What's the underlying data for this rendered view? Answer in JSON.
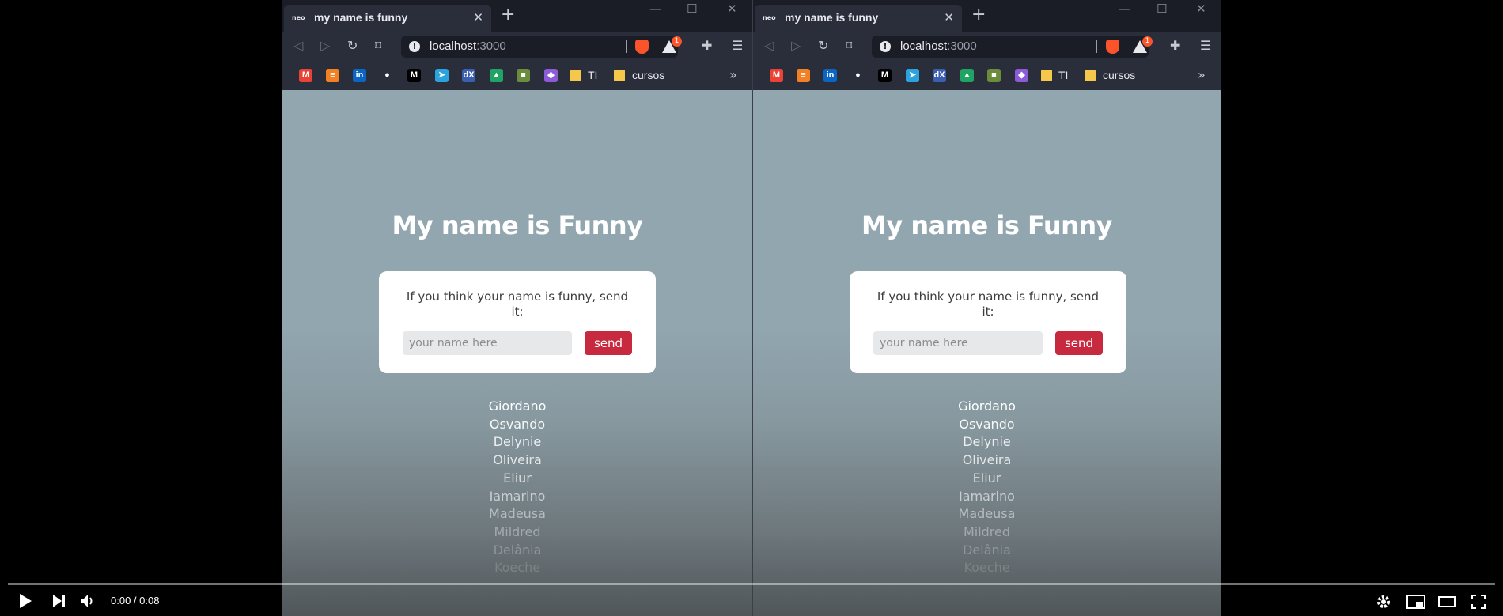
{
  "browser": {
    "tab_title": "my name is funny",
    "url_host": "localhost",
    "url_port": ":3000",
    "rewards_count": "1",
    "bookmarks": [
      {
        "icon": "gmail-icon",
        "color": "#ea4335",
        "glyph": "M"
      },
      {
        "icon": "stack-overflow-icon",
        "color": "#f48024",
        "glyph": "≡"
      },
      {
        "icon": "linkedin-icon",
        "color": "#0a66c2",
        "glyph": "in"
      },
      {
        "icon": "github-icon",
        "color": "#2a2e3b",
        "glyph": "●"
      },
      {
        "icon": "medium-icon",
        "color": "#000000",
        "glyph": "M"
      },
      {
        "icon": "telegram-icon",
        "color": "#2aa3df",
        "glyph": "➤"
      },
      {
        "icon": "edx-icon",
        "color": "#3a5fb0",
        "glyph": "dX"
      },
      {
        "icon": "google-drive-icon",
        "color": "#1fa463",
        "glyph": "▲"
      },
      {
        "icon": "minecraft-icon",
        "color": "#6b8c3a",
        "glyph": "■"
      },
      {
        "icon": "twitch-icon",
        "color": "#8e5bd8",
        "glyph": "◆"
      }
    ],
    "folder_1": "TI",
    "folder_2": "cursos"
  },
  "page": {
    "heading": "My name is Funny",
    "prompt": "If you think your name is funny, send it:",
    "input_placeholder": "your name here",
    "send_label": "send",
    "names": [
      "Giordano",
      "Osvando",
      "Delynie",
      "Oliveira",
      "Eliur",
      "Iamarino",
      "Madeusa",
      "Mildred",
      "Delânia",
      "Koeche"
    ],
    "name_colors": [
      "#ffffff",
      "#f7f8f8",
      "#eef0f1",
      "#e4e7e8",
      "#d8dbdd",
      "#c9cdd0",
      "#b8bcbf",
      "#a4a9ac",
      "#90959a",
      "#7d8286"
    ]
  },
  "player": {
    "time": "0:00 / 0:08",
    "progress": 0
  }
}
